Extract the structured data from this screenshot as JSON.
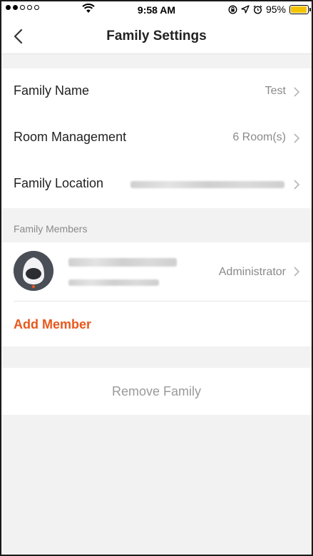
{
  "status_bar": {
    "time": "9:58 AM",
    "battery": "95%",
    "battery_level": 0.95,
    "signal_icons": [
      "signal-dots-icon",
      "wifi-icon"
    ],
    "right_icons": [
      "orientation-lock-icon",
      "location-arrow-icon",
      "alarm-icon",
      "battery-icon"
    ]
  },
  "navbar": {
    "title": "Family Settings",
    "back_icon": "chevron-left-icon"
  },
  "settings": {
    "family_name": {
      "label": "Family Name",
      "value": "Test"
    },
    "room_management": {
      "label": "Room Management",
      "value": "6 Room(s)"
    },
    "family_location": {
      "label": "Family Location",
      "value": ""
    }
  },
  "members": {
    "header": "Family Members",
    "items": [
      {
        "name": "",
        "account": "",
        "role": "Administrator",
        "avatar_icon": "robot-avatar-icon"
      }
    ],
    "add_label": "Add Member"
  },
  "remove_family": {
    "label": "Remove Family"
  },
  "colors": {
    "accent": "#e8581c",
    "background": "#f2f2f2",
    "secondary_text": "#8a8a8a",
    "battery": "#f5c400"
  }
}
